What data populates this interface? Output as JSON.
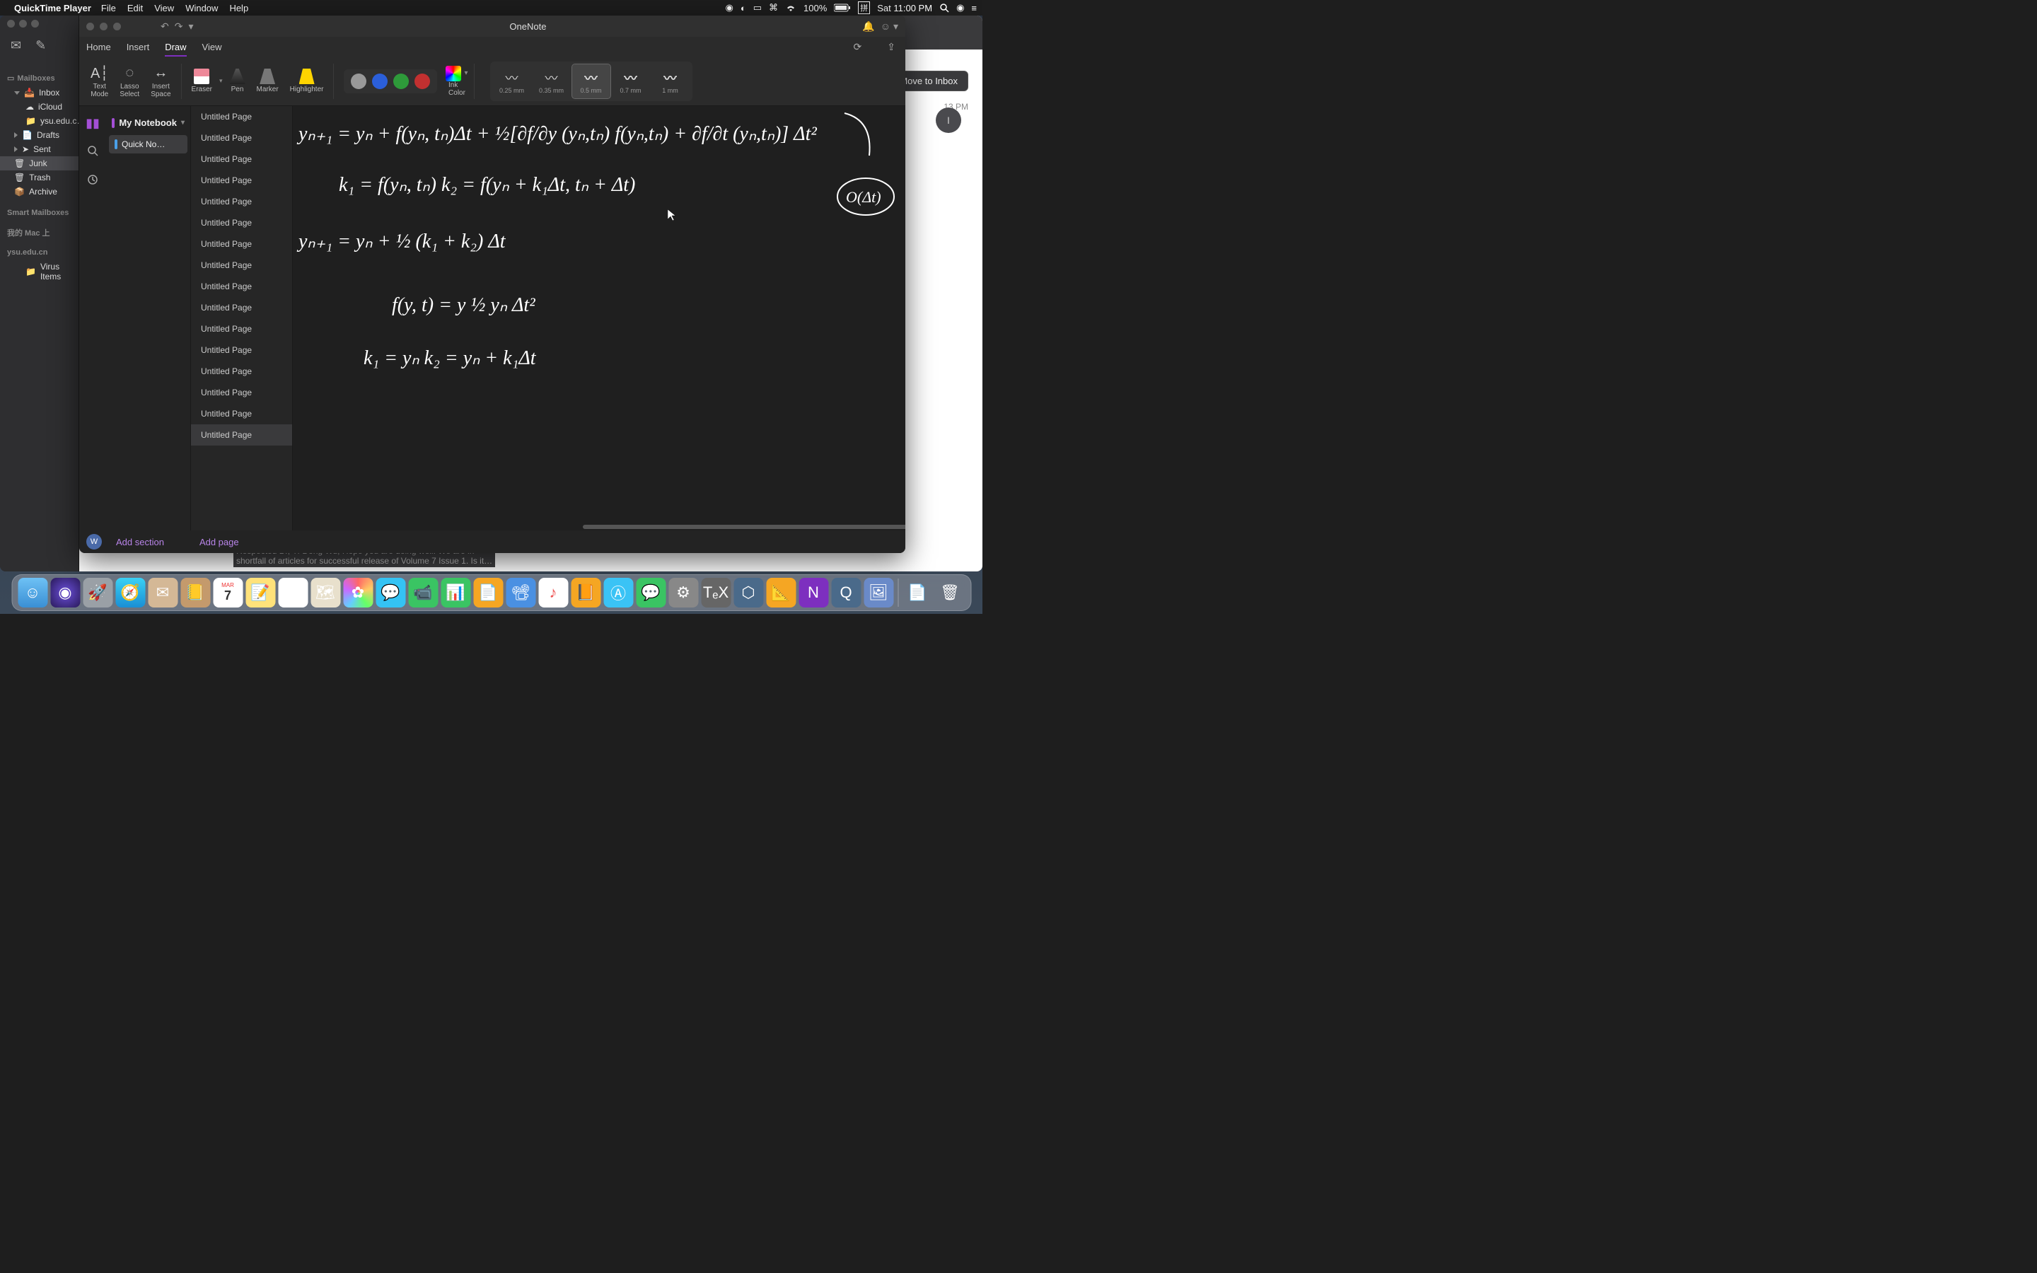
{
  "menubar": {
    "app": "QuickTime Player",
    "menus": [
      "File",
      "Edit",
      "View",
      "Window",
      "Help"
    ],
    "battery": "100%",
    "clock": "Sat 11:00 PM",
    "ime": "拼"
  },
  "mail": {
    "sidebar": {
      "mailboxes_header": "Mailboxes",
      "inbox": "Inbox",
      "icloud": "iCloud",
      "ysu": "ysu.edu.c…",
      "drafts": "Drafts",
      "sent": "Sent",
      "junk": "Junk",
      "trash": "Trash",
      "archive": "Archive",
      "smart_header": "Smart Mailboxes",
      "on_my_mac": "我的 Mac 上",
      "ysu_account": "ysu.edu.cn",
      "virus": "Virus Items"
    },
    "move_to_inbox": "Move to Inbox",
    "time": "13 PM",
    "avatar_initial": "I",
    "body_peek1": "Respected Dr, Yi-Dong Wu, Hope you are doing well. We are in",
    "body_peek2": "shortfall of articles for successful release of Volume 7 Issue 1. Is it…"
  },
  "onenote": {
    "title": "OneNote",
    "tabs": {
      "home": "Home",
      "insert": "Insert",
      "draw": "Draw",
      "view": "View"
    },
    "ribbon": {
      "text_mode": "Text\nMode",
      "lasso": "Lasso\nSelect",
      "insert_space": "Insert\nSpace",
      "eraser": "Eraser",
      "pen": "Pen",
      "marker": "Marker",
      "highlighter": "Highlighter",
      "ink_color": "Ink\nColor",
      "thickness": [
        "0.25 mm",
        "0.35 mm",
        "0.5 mm",
        "0.7 mm",
        "1 mm"
      ]
    },
    "notebook": "My Notebook",
    "section": "Quick No…",
    "pages": [
      "Untitled Page",
      "Untitled Page",
      "Untitled Page",
      "Untitled Page",
      "Untitled Page",
      "Untitled Page",
      "Untitled Page",
      "Untitled Page",
      "Untitled Page",
      "Untitled Page",
      "Untitled Page",
      "Untitled Page",
      "Untitled Page",
      "Untitled Page",
      "Untitled Page",
      "Untitled Page"
    ],
    "selected_page_index": 15,
    "footer": {
      "avatar": "W",
      "add_section": "Add section",
      "add_page": "Add page"
    },
    "math_lines": [
      "yₙ₊₁ = yₙ + f(yₙ, tₙ)Δt + ½[∂f/∂y (yₙ,tₙ) f(yₙ,tₙ) + ∂f/∂t (yₙ,tₙ)] Δt²",
      "k₁ = f(yₙ, tₙ)        k₂ = f(yₙ + k₁Δt,  tₙ + Δt)",
      "yₙ₊₁ = yₙ + ½ (k₁ + k₂) Δt",
      "f(y, t) = y                          ½ yₙ Δt²",
      "k₁ = yₙ        k₂ = yₙ + k₁Δt"
    ],
    "circled_note": "O(Δt)"
  },
  "calendar_icon": {
    "month": "MAR",
    "day": "7"
  },
  "dock_apps": [
    "Finder",
    "Siri",
    "Launchpad",
    "Safari",
    "Mail",
    "Contacts",
    "Calendar",
    "Notes",
    "Reminders",
    "Maps",
    "Photos",
    "Messages",
    "FaceTime",
    "Numbers",
    "Pages",
    "Keynote",
    "iTunes",
    "Books",
    "App Store",
    "WeChat",
    "Preferences",
    "TeXShop",
    "Octave",
    "MATLAB",
    "OneNote",
    "QuickTime",
    "Preview"
  ]
}
